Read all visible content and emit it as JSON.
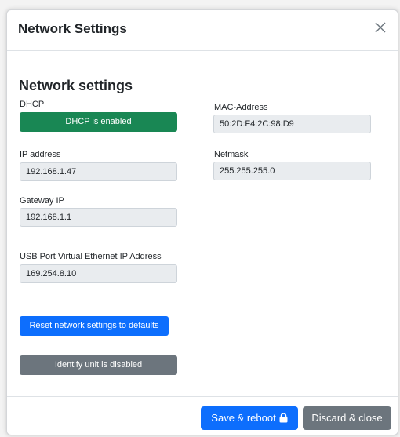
{
  "dialog": {
    "title": "Network Settings",
    "close_icon": "close-icon"
  },
  "section": {
    "title": "Network settings"
  },
  "dhcp": {
    "label": "DHCP",
    "button_label": "DHCP is enabled",
    "color": "#198754"
  },
  "mac": {
    "label": "MAC-Address",
    "value": "50:2D:F4:2C:98:D9"
  },
  "ip": {
    "label": "IP address",
    "value": "192.168.1.47"
  },
  "netmask": {
    "label": "Netmask",
    "value": "255.255.255.0"
  },
  "gateway": {
    "label": "Gateway IP",
    "value": "192.168.1.1"
  },
  "usb": {
    "label": "USB Port Virtual Ethernet IP Address",
    "value": "169.254.8.10"
  },
  "actions": {
    "reset_label": "Reset network settings to defaults",
    "identify_label": "Identify unit is disabled"
  },
  "footer": {
    "save_label": "Save & reboot",
    "save_icon": "lock-icon",
    "discard_label": "Discard & close"
  },
  "colors": {
    "primary": "#0d6efd",
    "success": "#198754",
    "secondary": "#6c757d"
  }
}
